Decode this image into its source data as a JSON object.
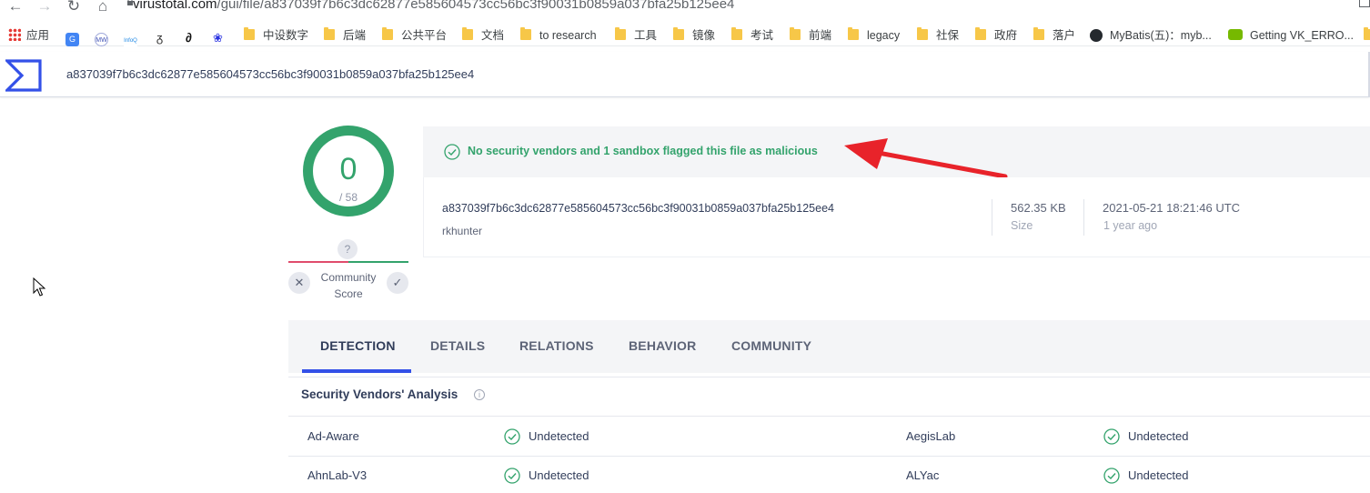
{
  "browser": {
    "url_host": "virustotal.com",
    "url_path": "/gui/file/a837039f7b6c3dc62877e585604573cc56bc3f90031b0859a037bfa25b125ee4",
    "bookmarks": [
      {
        "label": "应用",
        "icon": "apps-grid-icon"
      },
      {
        "label": "",
        "icon": "google-translate-icon"
      },
      {
        "label": "",
        "icon": "mw-icon"
      },
      {
        "label": "",
        "icon": "infoq-icon"
      },
      {
        "label": "",
        "icon": "script-icon"
      },
      {
        "label": "",
        "icon": "curl-icon"
      },
      {
        "label": "",
        "icon": "baidu-icon"
      },
      {
        "label": "中设数字",
        "icon": "folder-icon"
      },
      {
        "label": "后端",
        "icon": "folder-icon"
      },
      {
        "label": "公共平台",
        "icon": "folder-icon"
      },
      {
        "label": "文档",
        "icon": "folder-icon"
      },
      {
        "label": "to research",
        "icon": "folder-icon"
      },
      {
        "label": "工具",
        "icon": "folder-icon"
      },
      {
        "label": "镜像",
        "icon": "folder-icon"
      },
      {
        "label": "考试",
        "icon": "folder-icon"
      },
      {
        "label": "前端",
        "icon": "folder-icon"
      },
      {
        "label": "legacy",
        "icon": "folder-icon"
      },
      {
        "label": "社保",
        "icon": "folder-icon"
      },
      {
        "label": "政府",
        "icon": "folder-icon"
      },
      {
        "label": "落户",
        "icon": "folder-icon"
      },
      {
        "label": "MyBatis(五)：myb...",
        "icon": "github-icon"
      },
      {
        "label": "Getting VK_ERRO...",
        "icon": "nvidia-icon"
      }
    ]
  },
  "vt": {
    "search_value": "a837039f7b6c3dc62877e585604573cc56bc3f90031b0859a037bfa25b125ee4",
    "score": {
      "detections": "0",
      "total": "/ 58"
    },
    "community": {
      "question": "?",
      "label_line1": "Community",
      "label_line2": "Score"
    },
    "verdict": "No security vendors and 1 sandbox flagged this file as malicious",
    "file": {
      "hash": "a837039f7b6c3dc62877e585604573cc56bc3f90031b0859a037bfa25b125ee4",
      "name": "rkhunter",
      "size": "562.35 KB",
      "size_label": "Size",
      "date": "2021-05-21 18:21:46 UTC",
      "date_relative": "1 year ago"
    },
    "tabs": [
      "DETECTION",
      "DETAILS",
      "RELATIONS",
      "BEHAVIOR",
      "COMMUNITY"
    ],
    "active_tab": "DETECTION",
    "section_title": "Security Vendors' Analysis",
    "vendors": [
      {
        "left_name": "Ad-Aware",
        "left_result": "Undetected",
        "right_name": "AegisLab",
        "right_result": "Undetected"
      },
      {
        "left_name": "AhnLab-V3",
        "left_result": "Undetected",
        "right_name": "ALYac",
        "right_result": "Undetected"
      }
    ]
  },
  "colors": {
    "clean_green": "#33a36c",
    "accent_blue": "#3350e8",
    "annotation_red": "#e8232a"
  }
}
